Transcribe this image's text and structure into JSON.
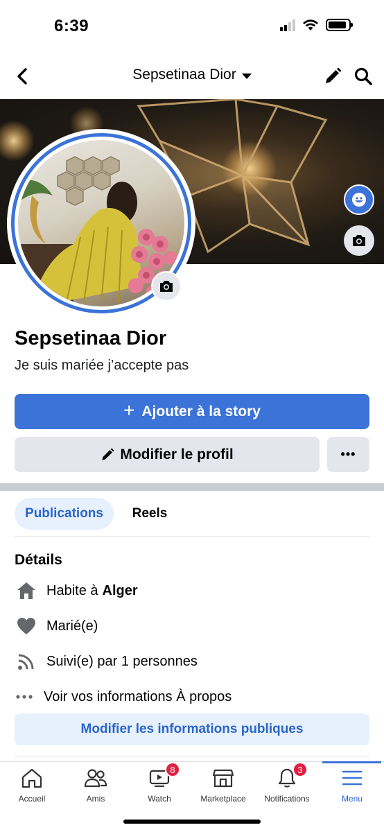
{
  "status": {
    "time": "6:39",
    "battery_level": 0.9
  },
  "header": {
    "title": "Sepsetinaa Dior",
    "back_icon": "chevron-left-icon",
    "edit_icon": "pencil-icon",
    "search_icon": "search-icon"
  },
  "cover": {
    "edit_icon": "avatar-edit-icon",
    "camera_icon": "camera-icon"
  },
  "profile": {
    "name": "Sepsetinaa Dior",
    "bio": "Je suis mariée j’accepte pas"
  },
  "actions": {
    "add_story": "Ajouter à la story",
    "add_story_plus": "+",
    "edit_profile": "Modifier le profil",
    "more": "•••"
  },
  "tabs": {
    "publications": "Publications",
    "reels": "Reels"
  },
  "details": {
    "title": "Détails",
    "lives_prefix": "Habite à",
    "lives_city": "Alger",
    "relationship": "Marié(e)",
    "followers": "Suivi(e) par 1 personnes",
    "see_about": "Voir vos informations À propos",
    "edit_public": "Modifier les informations publiques"
  },
  "tab_bar": {
    "items": [
      {
        "label": "Accueil",
        "icon": "home-icon"
      },
      {
        "label": "Amis",
        "icon": "friends-icon"
      },
      {
        "label": "Watch",
        "icon": "watch-icon",
        "badge": "8"
      },
      {
        "label": "Marketplace",
        "icon": "marketplace-icon"
      },
      {
        "label": "Notifications",
        "icon": "bell-icon",
        "badge": "3"
      },
      {
        "label": "Menu",
        "icon": "menu-icon",
        "active": true
      }
    ]
  },
  "colors": {
    "accent": "#3b73d8",
    "accent_text": "#2b66c9",
    "accent_soft": "#e7f0fd",
    "button_grey": "#e4e6eb",
    "badge_red": "#e41e3f"
  }
}
